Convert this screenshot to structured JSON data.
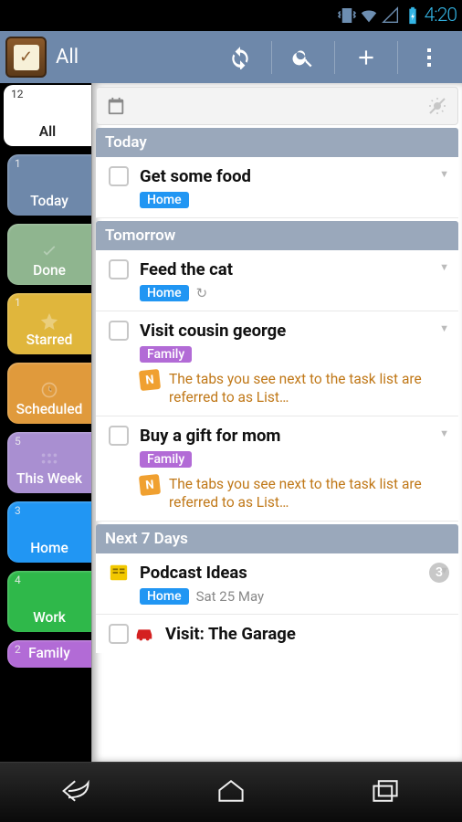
{
  "status": {
    "time": "4:20"
  },
  "actionbar": {
    "title": "All"
  },
  "sidebar": [
    {
      "id": "all",
      "count": "12",
      "label": "All",
      "color": "",
      "active": true
    },
    {
      "id": "today",
      "count": "1",
      "label": "Today",
      "color": "#6e88aa"
    },
    {
      "id": "done",
      "count": "",
      "label": "Done",
      "color": "#8fb58f",
      "icon": "check"
    },
    {
      "id": "starred",
      "count": "1",
      "label": "Starred",
      "color": "#e0b63c",
      "icon": "star"
    },
    {
      "id": "scheduled",
      "count": "",
      "label": "Scheduled",
      "color": "#e09a3c",
      "icon": "clock"
    },
    {
      "id": "thisweek",
      "count": "5",
      "label": "This Week",
      "color": "#a98fd1",
      "icon": "week"
    },
    {
      "id": "home",
      "count": "3",
      "label": "Home",
      "color": "#2196f3"
    },
    {
      "id": "work",
      "count": "4",
      "label": "Work",
      "color": "#2fb84a"
    },
    {
      "id": "family",
      "count": "2",
      "label": "Family",
      "color": "#b26bd6",
      "cut": true
    }
  ],
  "sections": {
    "today": "Today",
    "tomorrow": "Tomorrow",
    "next7": "Next 7 Days"
  },
  "tasks": {
    "t1": {
      "title": "Get some food",
      "tag": "Home",
      "tagClass": "home"
    },
    "t2": {
      "title": "Feed the cat",
      "tag": "Home",
      "tagClass": "home",
      "repeat": true
    },
    "t3": {
      "title": "Visit cousin george",
      "tag": "Family",
      "tagClass": "family",
      "note": "The tabs you see next to the task list are referred to as List…"
    },
    "t4": {
      "title": "Buy a gift for mom",
      "tag": "Family",
      "tagClass": "family",
      "note": "The tabs you see next to the task list are referred to as List…"
    },
    "t5": {
      "title": "Podcast Ideas",
      "tag": "Home",
      "tagClass": "home",
      "count": "3",
      "date": "Sat 25 May",
      "icon": "note"
    },
    "t6": {
      "title": "Visit: The Garage",
      "icon": "car"
    }
  }
}
